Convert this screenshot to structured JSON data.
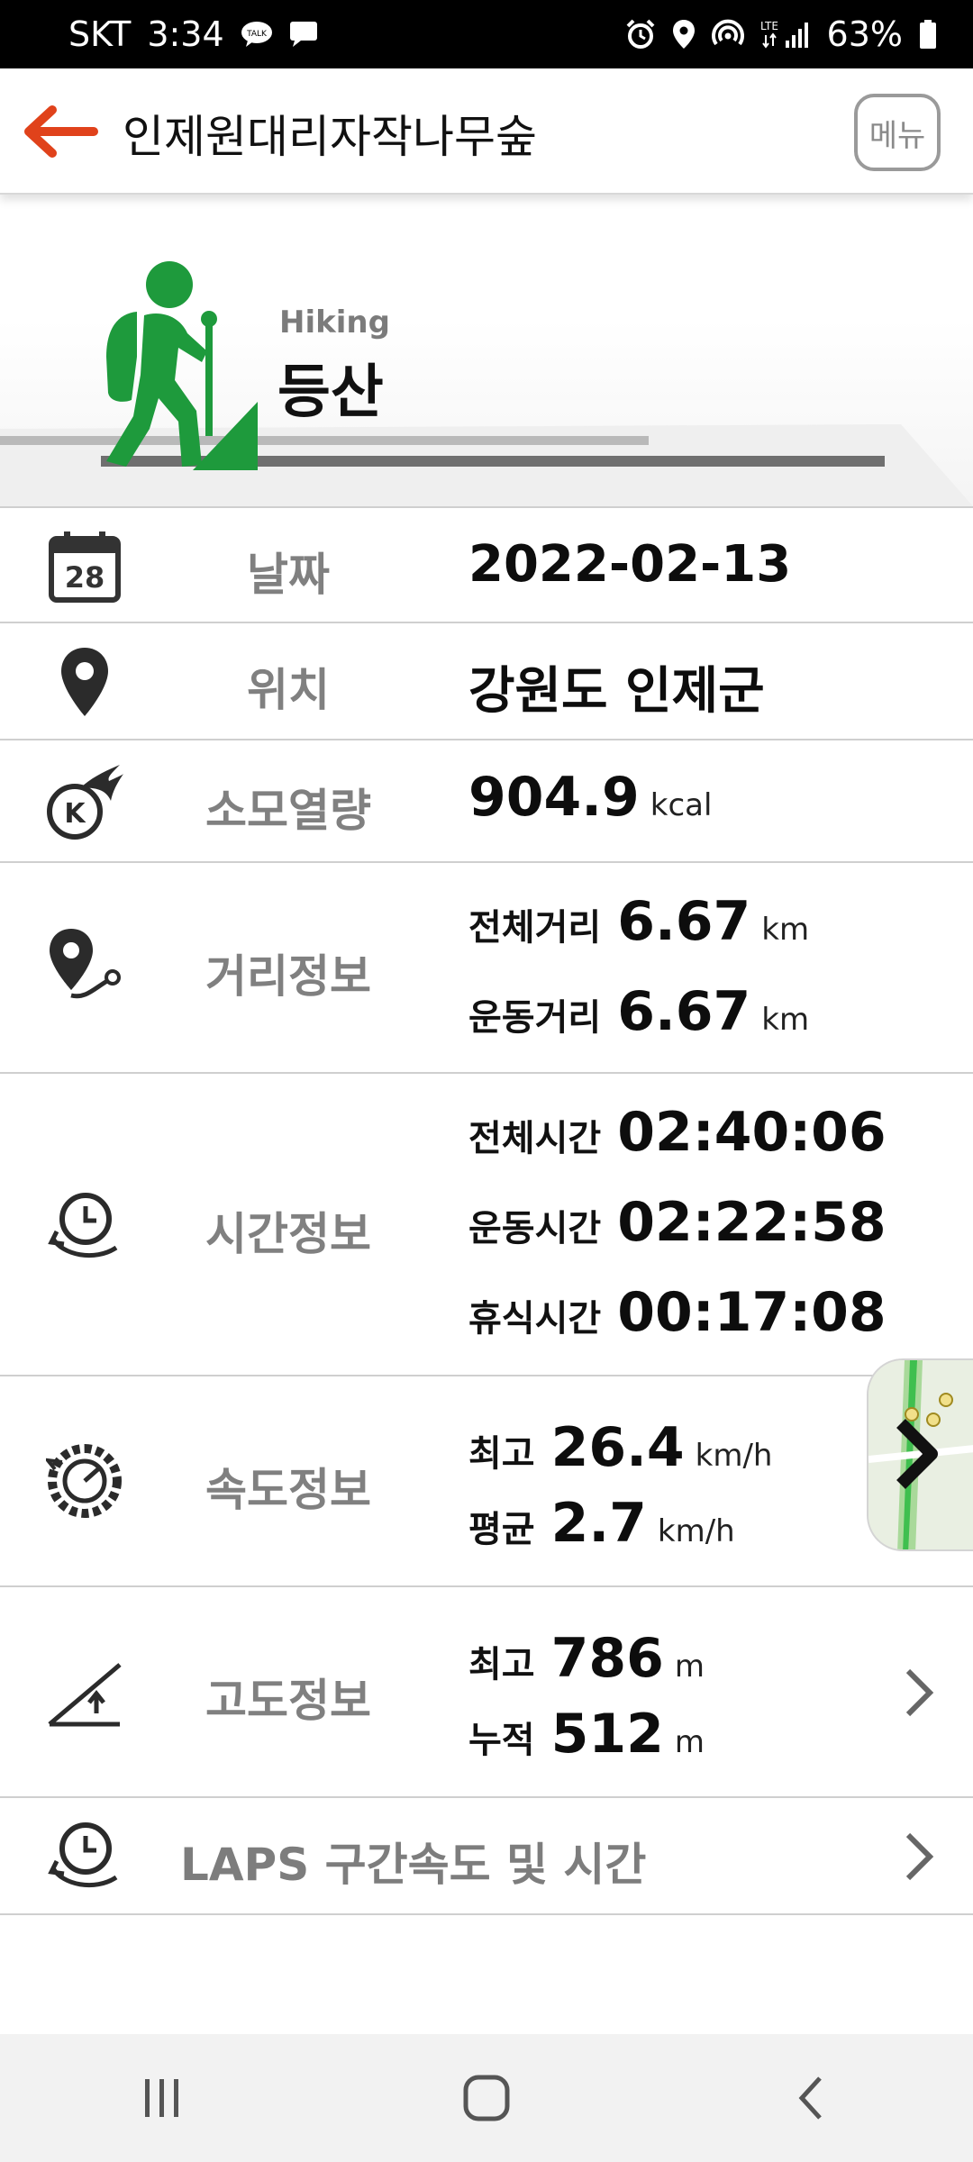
{
  "status_bar": {
    "carrier": "SKT",
    "time": "3:34",
    "network": "LTE",
    "battery": "63%"
  },
  "app_bar": {
    "title": "인제원대리자작나무숲",
    "menu_label": "메뉴"
  },
  "activity": {
    "name_en": "Hiking",
    "name_ko": "등산",
    "icon_color": "#1e9a3c"
  },
  "info": {
    "date": {
      "label": "날짜",
      "value": "2022-02-13",
      "icon_day": "28"
    },
    "location": {
      "label": "위치",
      "value": "강원도 인제군"
    },
    "calories": {
      "label": "소모열량",
      "value": "904.9",
      "unit": "kcal"
    },
    "distance": {
      "label": "거리정보",
      "items": [
        {
          "key": "전체거리",
          "value": "6.67",
          "unit": "km"
        },
        {
          "key": "운동거리",
          "value": "6.67",
          "unit": "km"
        }
      ]
    },
    "time": {
      "label": "시간정보",
      "items": [
        {
          "key": "전체시간",
          "value": "02:40:06"
        },
        {
          "key": "운동시간",
          "value": "02:22:58"
        },
        {
          "key": "휴식시간",
          "value": "00:17:08"
        }
      ]
    },
    "speed": {
      "label": "속도정보",
      "items": [
        {
          "key": "최고",
          "value": "26.4",
          "unit": "km/h"
        },
        {
          "key": "평균",
          "value": "2.7",
          "unit": "km/h"
        }
      ]
    },
    "altitude": {
      "label": "고도정보",
      "items": [
        {
          "key": "최고",
          "value": "786",
          "unit": "m"
        },
        {
          "key": "누적",
          "value": "512",
          "unit": "m"
        }
      ]
    },
    "laps": {
      "label": "LAPS 구간속도 및 시간"
    }
  },
  "colors": {
    "accent": "#e0421b",
    "label_gray": "#808080",
    "divider": "#cfcfcf"
  }
}
